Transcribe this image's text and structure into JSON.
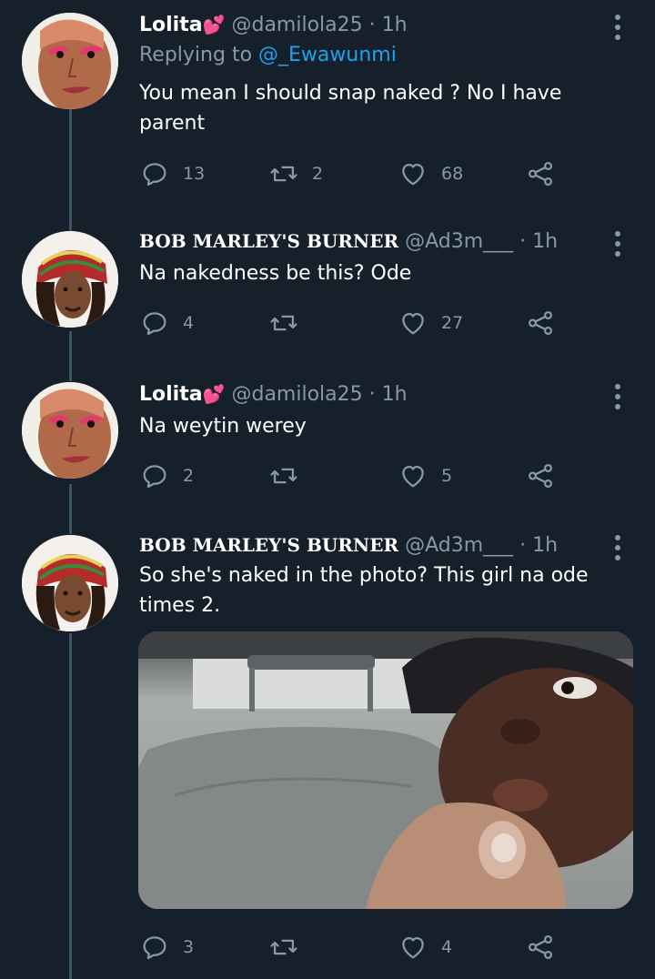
{
  "tweets": [
    {
      "name": "Lolita",
      "name_emoji": "💕",
      "handle": "@damilola25",
      "separator": "·",
      "time": "1h",
      "replying_prefix": "Replying to",
      "replying_to": "@_Ewawunmi",
      "text": "You mean I should snap naked ? No I have parent",
      "replies": "13",
      "retweets": "2",
      "likes": "68"
    },
    {
      "name": "BOB MARLEY'S BURNER",
      "handle": "@Ad3m___",
      "separator": "·",
      "time": "1h",
      "text": "Na nakedness be this? Ode",
      "replies": "4",
      "retweets": "",
      "likes": "27"
    },
    {
      "name": "Lolita",
      "name_emoji": "💕",
      "handle": "@damilola25",
      "separator": "·",
      "time": "1h",
      "text": "Na weytin werey",
      "replies": "2",
      "retweets": "",
      "likes": "5"
    },
    {
      "name": "BOB MARLEY'S BURNER",
      "handle": "@Ad3m___",
      "separator": "·",
      "time": "1h",
      "text": "So she's naked in the photo? This girl na ode times 2.",
      "replies": "3",
      "retweets": "",
      "likes": "4"
    }
  ],
  "icons": {
    "reply": "reply-icon",
    "retweet": "retweet-icon",
    "like": "heart-icon",
    "share": "share-icon",
    "more": "more-vertical-icon"
  },
  "colors": {
    "background": "#15202b",
    "secondary_text": "#8899a6",
    "accent": "#1da1f2",
    "thread_line": "#3d5466"
  }
}
